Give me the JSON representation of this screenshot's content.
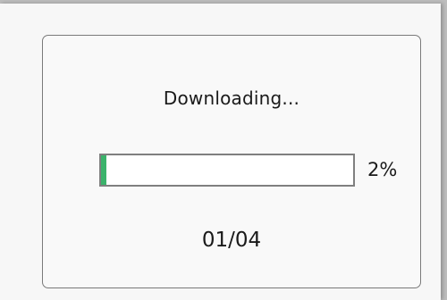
{
  "dialog": {
    "title": "Downloading...",
    "progress": {
      "percent_value": 2,
      "percent_label": "2%",
      "fill_color": "#3bb36b"
    },
    "file_counter": "01/04"
  }
}
